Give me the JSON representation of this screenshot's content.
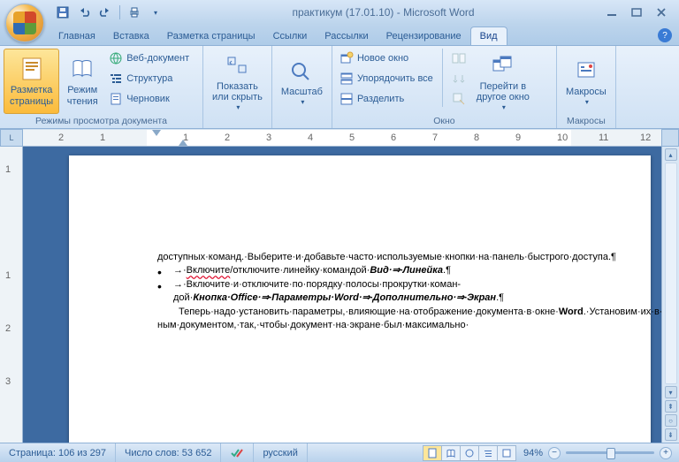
{
  "window": {
    "title": "практикум (17.01.10) - Microsoft Word"
  },
  "qat": {
    "save": "Сохранить",
    "undo": "Отменить",
    "redo": "Повторить",
    "print": "Быстрая печать"
  },
  "tabs": {
    "items": [
      "Главная",
      "Вставка",
      "Разметка страницы",
      "Ссылки",
      "Рассылки",
      "Рецензирование",
      "Вид"
    ],
    "active": 6
  },
  "ribbon": {
    "views_group_label": "Режимы просмотра документа",
    "page_layout": "Разметка\nстраницы",
    "reading": "Режим\nчтения",
    "web": "Веб-документ",
    "outline": "Структура",
    "draft": "Черновик",
    "show_hide_group": "Показать\nили скрыть",
    "zoom_group": "Масштаб",
    "window_group_label": "Окно",
    "new_window": "Новое окно",
    "arrange": "Упорядочить все",
    "split": "Разделить",
    "switch": "Перейти в\nдругое окно",
    "macros_group_label": "Макросы",
    "macros": "Макросы"
  },
  "ruler_h_nums": [
    "2",
    "1",
    "",
    "1",
    "2",
    "3",
    "4",
    "5",
    "6",
    "7",
    "8",
    "9",
    "10",
    "11",
    "12"
  ],
  "ruler_v_nums": [
    "1",
    "",
    "1",
    "2",
    "3"
  ],
  "doc": {
    "p1": "доступных·команд.·Выберите·и·добавьте·часто·используемые·кнопки·на·панель·быстрого·доступа.¶",
    "b1_pre": "→·",
    "b1_txt": "Включите",
    "b1_post": "/отключите·линейку·командой·",
    "b1_bi1": "Вид·",
    "b1_arrow": "⇒·",
    "b1_bi2": "Линейка",
    "b1_end": ".¶",
    "b2_pre": "→·Включите·и·отключите·по·порядку·полосы·прокрутки·коман­дой·",
    "b2_bi1": "Кнопка·Office·",
    "b2_a1": "⇒·",
    "b2_bi2": "Параметры·Word·",
    "b2_a2": "⇒·",
    "b2_bi3": "Дополнительно·",
    "b2_a3": "⇒·",
    "b2_bi4": "Экран",
    "b2_end": ".¶",
    "p3a": "Теперь·надо·установить·параметры,·влияющие·на·отображение·документа·в·окне·",
    "p3w": "Word",
    "p3b": ".·Установим·их·в·расчете·на·работу·с·обыч­ным·документом,·так,·чтобы·документ·на·экране·был·максимально·"
  },
  "status": {
    "page": "Страница: 106 из 297",
    "words": "Число слов: 53 652",
    "lang": "русский",
    "zoom": "94%"
  }
}
